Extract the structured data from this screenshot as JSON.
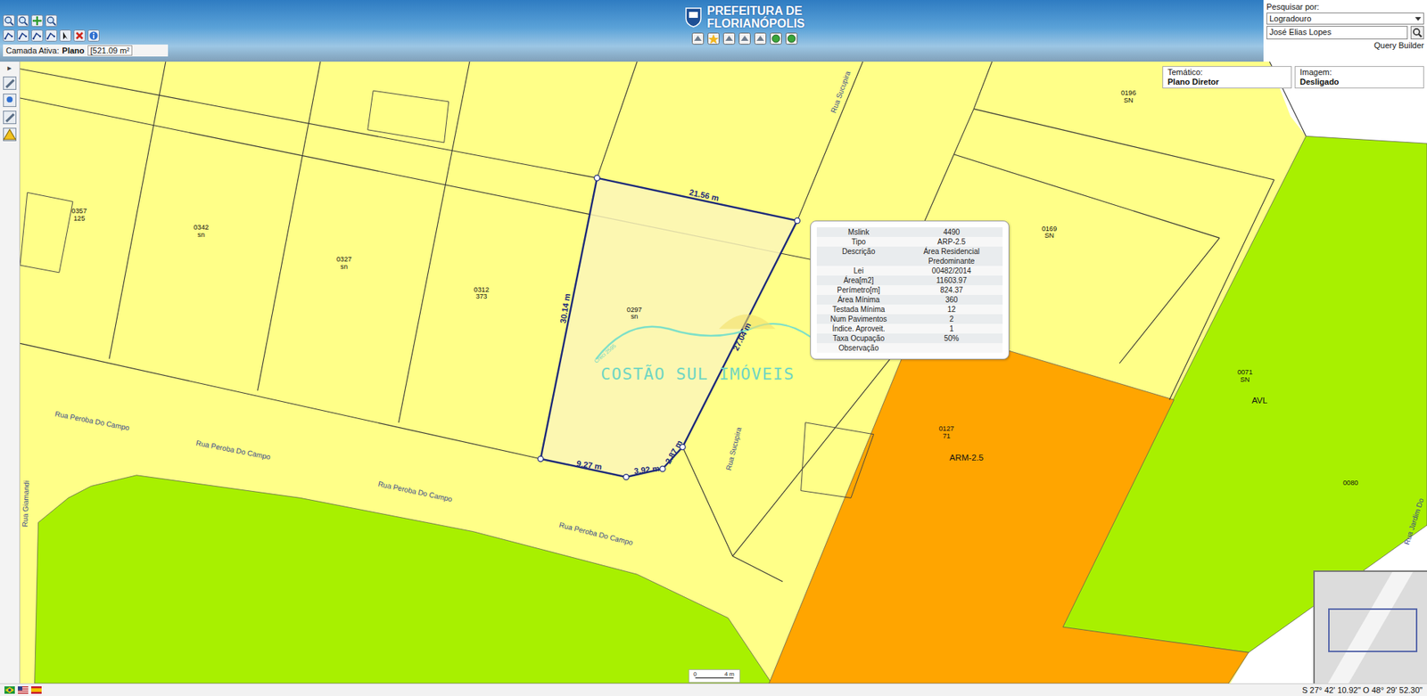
{
  "header": {
    "logo_line1": "PREFEITURA DE",
    "logo_line2": "FLORIANÓPOLIS",
    "active_layer_label": "Camada Ativa:",
    "active_layer_value": "Plano",
    "measure": "[521.09 m²"
  },
  "search": {
    "label": "Pesquisar por:",
    "field": "Logradouro",
    "query": "José Elias Lopes",
    "query_builder": "Query Builder"
  },
  "map_info": [
    {
      "label": "Temático:",
      "value": "Plano Diretor"
    },
    {
      "label": "Imagem:",
      "value": "Desligado"
    }
  ],
  "side_toggle": "▸",
  "popup": {
    "rows": [
      {
        "label": "Mslink",
        "value": "4490"
      },
      {
        "label": "Tipo",
        "value": "ARP-2.5"
      },
      {
        "label": "Descrição",
        "value": "Área Residencial Predominante"
      },
      {
        "label": "Lei",
        "value": "00482/2014"
      },
      {
        "label": "Área[m2]",
        "value": "11603.97"
      },
      {
        "label": "Perímetro[m]",
        "value": "824.37"
      },
      {
        "label": "Área Mínima",
        "value": "360"
      },
      {
        "label": "Testada Mínima",
        "value": "12"
      },
      {
        "label": "Num Pavimentos",
        "value": "2"
      },
      {
        "label": "Índice. Aproveit.",
        "value": "1"
      },
      {
        "label": "Taxa Ocupação",
        "value": "50%"
      },
      {
        "label": "Observação",
        "value": ""
      }
    ]
  },
  "parcel_edges": [
    "21.56 m",
    "30.14 m",
    "27.04 m",
    "9.27 m",
    "3.92 m",
    "2.87 m"
  ],
  "lots": [
    {
      "code": "0357",
      "number": "125"
    },
    {
      "code": "0342",
      "number": "sn"
    },
    {
      "code": "0327",
      "number": "sn"
    },
    {
      "code": "0312",
      "number": "373"
    },
    {
      "code": "0297",
      "number": "sn"
    },
    {
      "code": "0169",
      "number": "SN"
    },
    {
      "code": "0196",
      "number": "SN"
    },
    {
      "code": "0127",
      "number": "71"
    },
    {
      "code": "0071",
      "number": "SN"
    },
    {
      "code": "0080",
      "number": ""
    }
  ],
  "zones": [
    {
      "label": "ARM-2.5",
      "color": "#ffa500"
    },
    {
      "label": "AVL",
      "color": "#a8f000"
    }
  ],
  "streets": [
    "Rua Peroba Do Campo",
    "Rua Peroba Do Campo",
    "Rua Peroba Do Campo",
    "Rua Peroba Do Campo",
    "Rua Sucupira",
    "Rua Sucupira",
    "Rua Giamandi",
    "Rua Jardim Do"
  ],
  "watermark": {
    "name": "COSTÃO SUL IMÓVEIS",
    "creci": "Creci 2595"
  },
  "scale": {
    "start": "0",
    "end": "4 m"
  },
  "status": {
    "coordinates": "S 27° 42' 10.92\" O 48° 29' 52.30\""
  }
}
